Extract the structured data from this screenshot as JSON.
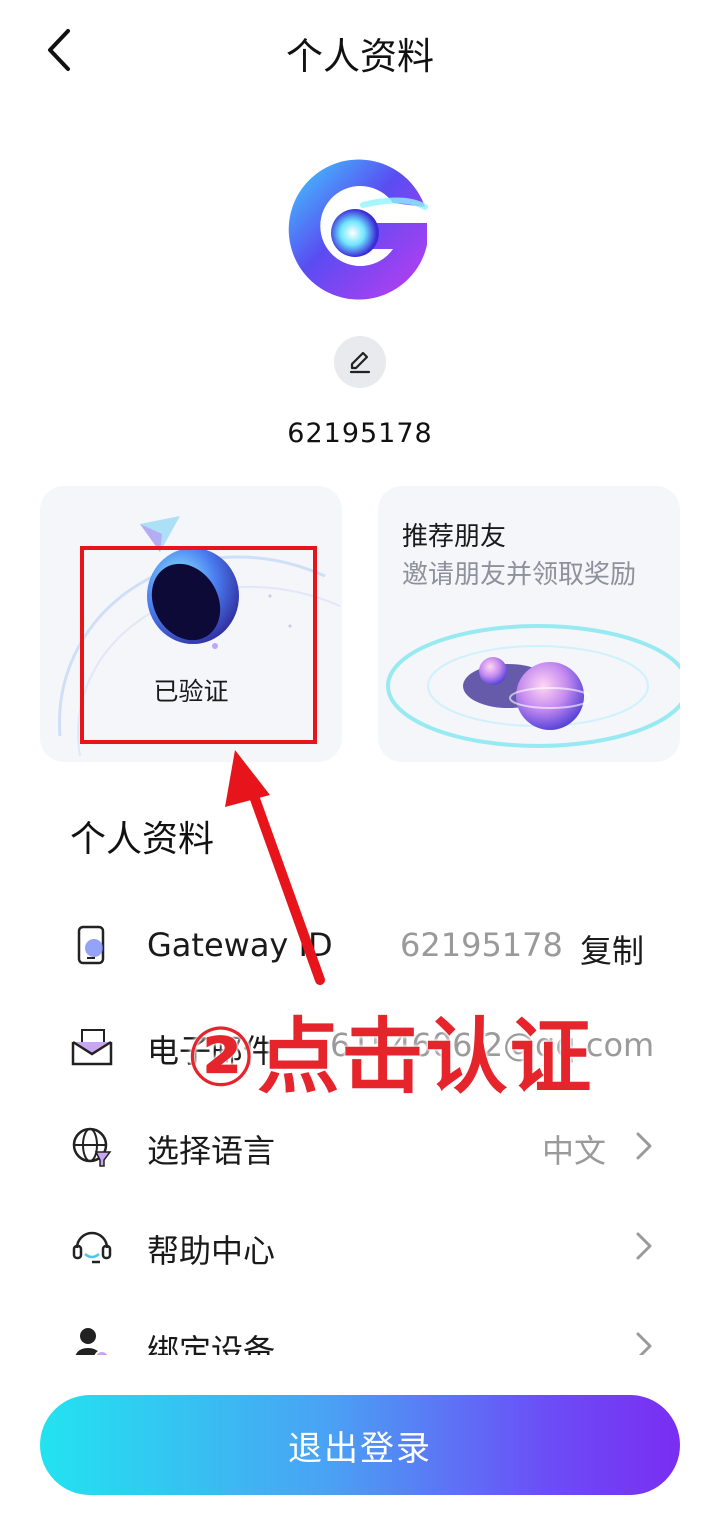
{
  "header": {
    "title": "个人资料"
  },
  "profile": {
    "user_id": "62195178"
  },
  "cards": {
    "verify": {
      "label": "已验证"
    },
    "refer": {
      "title": "推荐朋友",
      "subtitle": "邀请朋友并领取奖励"
    }
  },
  "section": {
    "title": "个人资料"
  },
  "rows": [
    {
      "icon": "phone-icon",
      "label": "Gateway ID",
      "value": "62195178",
      "action": "复制"
    },
    {
      "icon": "mail-icon",
      "label": "电子邮件",
      "value": "6154606.2@qq.com"
    },
    {
      "icon": "globe-icon",
      "label": "选择语言",
      "value": "中文"
    },
    {
      "icon": "headset-icon",
      "label": "帮助中心",
      "value": ""
    },
    {
      "icon": "user-device-icon",
      "label": "绑定设备",
      "value": ""
    }
  ],
  "logout": {
    "label": "退出登录"
  },
  "annotation": {
    "text": "②点击认证",
    "color": "#e6242c"
  },
  "colors": {
    "accent_start": "#22e3f0",
    "accent_end": "#7a2df2",
    "annotation_red": "#e8141b"
  }
}
